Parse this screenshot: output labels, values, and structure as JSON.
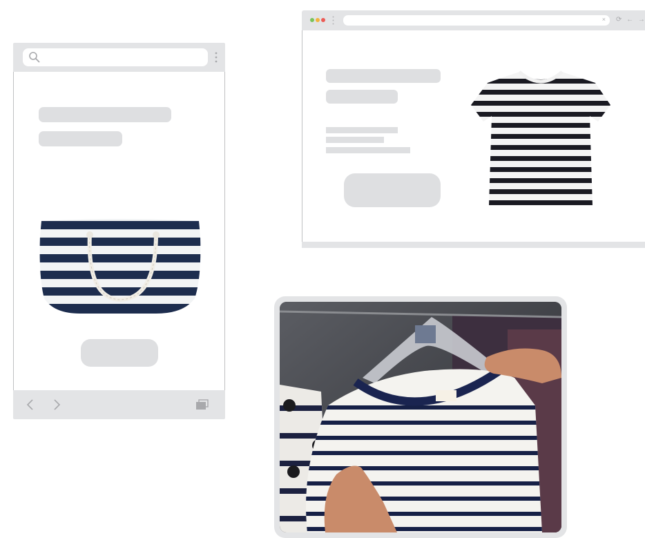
{
  "mobile": {
    "product_name": "striped-tote-bag",
    "icons": {
      "search": "search-icon",
      "menu": "kebab-menu-icon",
      "back": "chevron-left-icon",
      "forward": "chevron-right-icon",
      "tabs": "tabs-icon"
    }
  },
  "desktop": {
    "window_controls": [
      "#7ac35a",
      "#f2b33d",
      "#ec5b55"
    ],
    "url_clear": "×",
    "nav_glyphs": "⟳ ← →",
    "product_name": "striped-t-shirt"
  },
  "photo": {
    "subject": "hands-holding-striped-shirt-on-hanger"
  },
  "colors": {
    "navy": "#1d2d4e",
    "skeleton": "#dedfe1",
    "chrome": "#e3e4e6"
  }
}
